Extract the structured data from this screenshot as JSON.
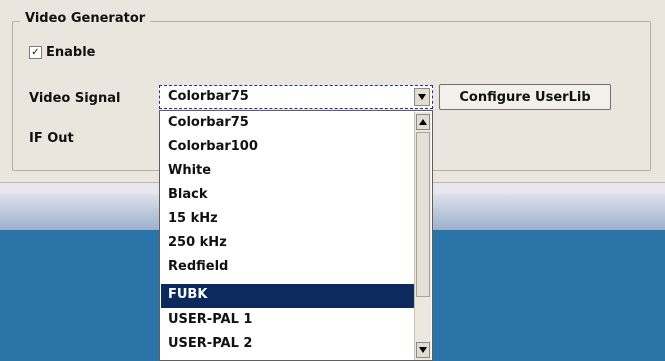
{
  "group": {
    "title": "Video Generator"
  },
  "enable": {
    "label": "Enable",
    "checked": true,
    "mark": "✓"
  },
  "labels": {
    "video_signal": "Video Signal",
    "if_out": "IF Out"
  },
  "combo": {
    "value": "Colorbar75",
    "icon": "chevron-down-icon"
  },
  "button": {
    "configure": "Configure UserLib"
  },
  "dropdown": {
    "items": [
      "Colorbar75",
      "Colorbar100",
      "White",
      "Black",
      "15 kHz",
      "250 kHz",
      "Redfield",
      "FUBK",
      "USER-PAL 1",
      "USER-PAL 2"
    ],
    "selected_index": 7,
    "selected_color": "#0c2a5d"
  },
  "colors": {
    "panel": "#ebe6dd",
    "desktop": "#2a74a8"
  }
}
